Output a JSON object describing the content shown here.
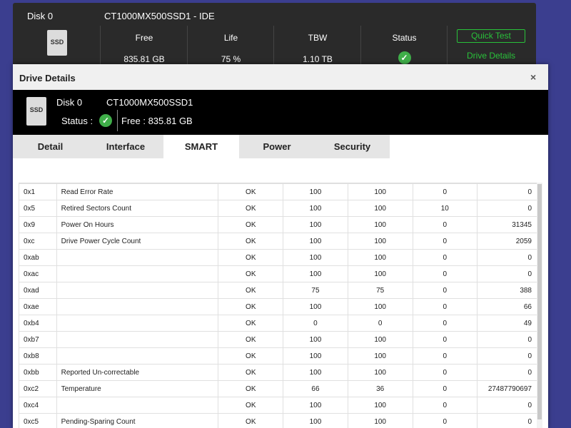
{
  "main": {
    "disk_label": "Disk 0",
    "model": "CT1000MX500SSD1 - IDE",
    "icon_text": "SSD",
    "columns": [
      {
        "label": "Free",
        "value": "835.81 GB"
      },
      {
        "label": "Life",
        "value": "75 %"
      },
      {
        "label": "TBW",
        "value": "1.10 TB"
      },
      {
        "label": "Status",
        "value": ""
      }
    ],
    "quick_test": "Quick Test",
    "drive_details": "Drive Details"
  },
  "dialog": {
    "title": "Drive Details",
    "close": "×",
    "icon_text": "SSD",
    "disk": "Disk   0",
    "model": "CT1000MX500SSD1",
    "status_label": "Status :",
    "free_label": "Free :  835.81 GB",
    "tabs": [
      "Detail",
      "Interface",
      "SMART",
      "Power",
      "Security"
    ],
    "active_tab": "SMART",
    "check_glyph": "✓"
  },
  "smart_rows": [
    [
      "0x1",
      "Read Error Rate",
      "OK",
      "100",
      "100",
      "0",
      "0"
    ],
    [
      "0x5",
      "Retired Sectors Count",
      "OK",
      "100",
      "100",
      "10",
      "0"
    ],
    [
      "0x9",
      "Power On Hours",
      "OK",
      "100",
      "100",
      "0",
      "31345"
    ],
    [
      "0xc",
      "Drive Power Cycle Count",
      "OK",
      "100",
      "100",
      "0",
      "2059"
    ],
    [
      "0xab",
      "",
      "OK",
      "100",
      "100",
      "0",
      "0"
    ],
    [
      "0xac",
      "",
      "OK",
      "100",
      "100",
      "0",
      "0"
    ],
    [
      "0xad",
      "",
      "OK",
      "75",
      "75",
      "0",
      "388"
    ],
    [
      "0xae",
      "",
      "OK",
      "100",
      "100",
      "0",
      "66"
    ],
    [
      "0xb4",
      "",
      "OK",
      "0",
      "0",
      "0",
      "49"
    ],
    [
      "0xb7",
      "",
      "OK",
      "100",
      "100",
      "0",
      "0"
    ],
    [
      "0xb8",
      "",
      "OK",
      "100",
      "100",
      "0",
      "0"
    ],
    [
      "0xbb",
      "Reported Un-correctable",
      "OK",
      "100",
      "100",
      "0",
      "0"
    ],
    [
      "0xc2",
      "Temperature",
      "OK",
      "66",
      "36",
      "0",
      "27487790697"
    ],
    [
      "0xc4",
      "",
      "OK",
      "100",
      "100",
      "0",
      "0"
    ],
    [
      "0xc5",
      "Pending-Sparing Count",
      "OK",
      "100",
      "100",
      "0",
      "0"
    ]
  ],
  "colors": {
    "accent_green": "#29c23a",
    "status_green": "#3fae49"
  }
}
